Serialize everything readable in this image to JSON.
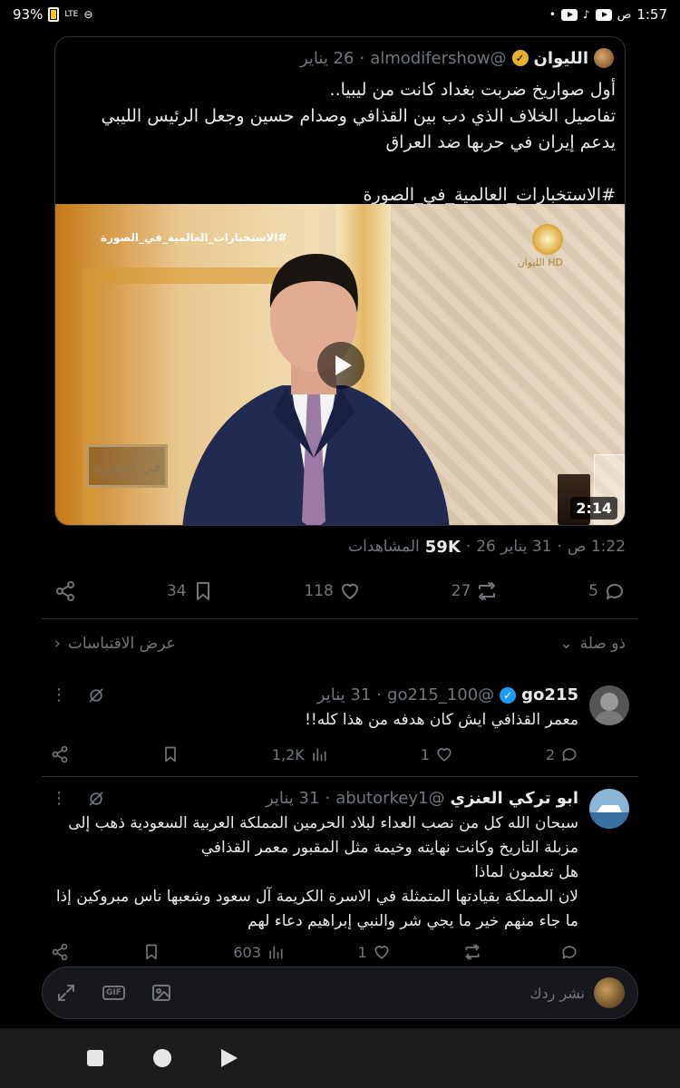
{
  "status_bar": {
    "time": "1:57",
    "period": "ص",
    "battery": "93%",
    "network": "LTE"
  },
  "quoted_tweet": {
    "author_name": "الليوان",
    "author_handle": "@almodifershow",
    "date": "26 يناير",
    "separator": "·",
    "text": "أول صواريخ ضربت بغداد كانت من ليبيا..\nتفاصيل الخلاف الذي دب بين القذافي وصدام حسين وجعل الرئيس الليبي يدعم إيران في حربها ضد العراق\n\n#الاستخبارات_العالمية_في_الصورة",
    "video": {
      "overlay_hashtag": "#الاستخبارات_العالمية_في_الصورة",
      "logo_text": "الليوان HD",
      "book_text": "في الصورة",
      "duration": "2:14"
    }
  },
  "meta": {
    "time": "1:22 ص",
    "date": "31 يناير 26",
    "views_count": "59K",
    "views_label": "المشاهدات",
    "separator": "·"
  },
  "stats": {
    "replies": "5",
    "retweets": "27",
    "likes": "118",
    "bookmarks": "34"
  },
  "sort_bar": {
    "relevance": "ذو صلة",
    "quotes": "عرض الاقتباسات"
  },
  "replies": [
    {
      "name": "go215",
      "handle": "@go215_100",
      "date": "31 يناير",
      "text": "معمر القذافي ايش كان هدفه من هذا كله!!",
      "replies": "2",
      "retweets": "",
      "likes": "1",
      "views": "1,2K",
      "verified": true
    },
    {
      "name": "ابو تركي العنزي",
      "handle": "@abutorkey1",
      "date": "31 يناير",
      "text": "سبحان الله كل من نصب العداء لبلاد الحرمين المملكة العربية السعودية ذهب إلى مزبلة التاريخ وكانت نهايته وخيمة مثل المقبور معمر القذافي\nهل تعلمون لماذا\nلان المملكة بقيادتها المتمثلة في الاسرة الكريمة آل سعود وشعبها ناس مبروكين إذا ما جاء منهم خير ما يجي شر والنبي إبراهيم دعاء لهم",
      "replies": "",
      "retweets": "",
      "likes": "1",
      "views": "603",
      "verified": false
    }
  ],
  "compose": {
    "placeholder": "نشر ردك"
  },
  "colors": {
    "background": "#000000",
    "text": "#e7e9ea",
    "dim": "#71767b",
    "border": "#2f3336",
    "verified_blue": "#1d9bf0",
    "verified_gold": "#e8b02f"
  }
}
